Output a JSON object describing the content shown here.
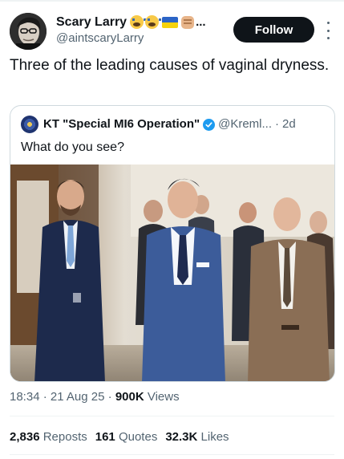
{
  "author": {
    "display_name": "Scary Larry",
    "handle": "@aintscaryLarry",
    "name_emoji": [
      "screaming-face-emoji",
      "ukraine-flag-emoji",
      "raised-fist-emoji"
    ],
    "name_overflow": "..."
  },
  "follow_button": {
    "label": "Follow"
  },
  "tweet": {
    "text": "Three of the leading causes of vaginal dryness."
  },
  "quoted": {
    "name": "KT \"Special MI6 Operation\"",
    "verified": true,
    "handle": "@Kreml...",
    "separator": "·",
    "time": "2d",
    "text": "What do you see?",
    "media_icon": "photo-of-three-men-in-suits"
  },
  "meta": {
    "time": "18:34",
    "date": "21 Aug 25",
    "views_count": "900K",
    "views_label": "Views",
    "separator": "·"
  },
  "stats": {
    "reposts_count": "2,836",
    "reposts_label": "Reposts",
    "quotes_count": "161",
    "quotes_label": "Quotes",
    "likes_count": "32.3K",
    "likes_label": "Likes"
  },
  "colors": {
    "text_primary": "#0f1419",
    "text_secondary": "#536471",
    "border": "#cfd9de",
    "verified": "#1d9bf0",
    "follow_bg": "#0f1419"
  }
}
